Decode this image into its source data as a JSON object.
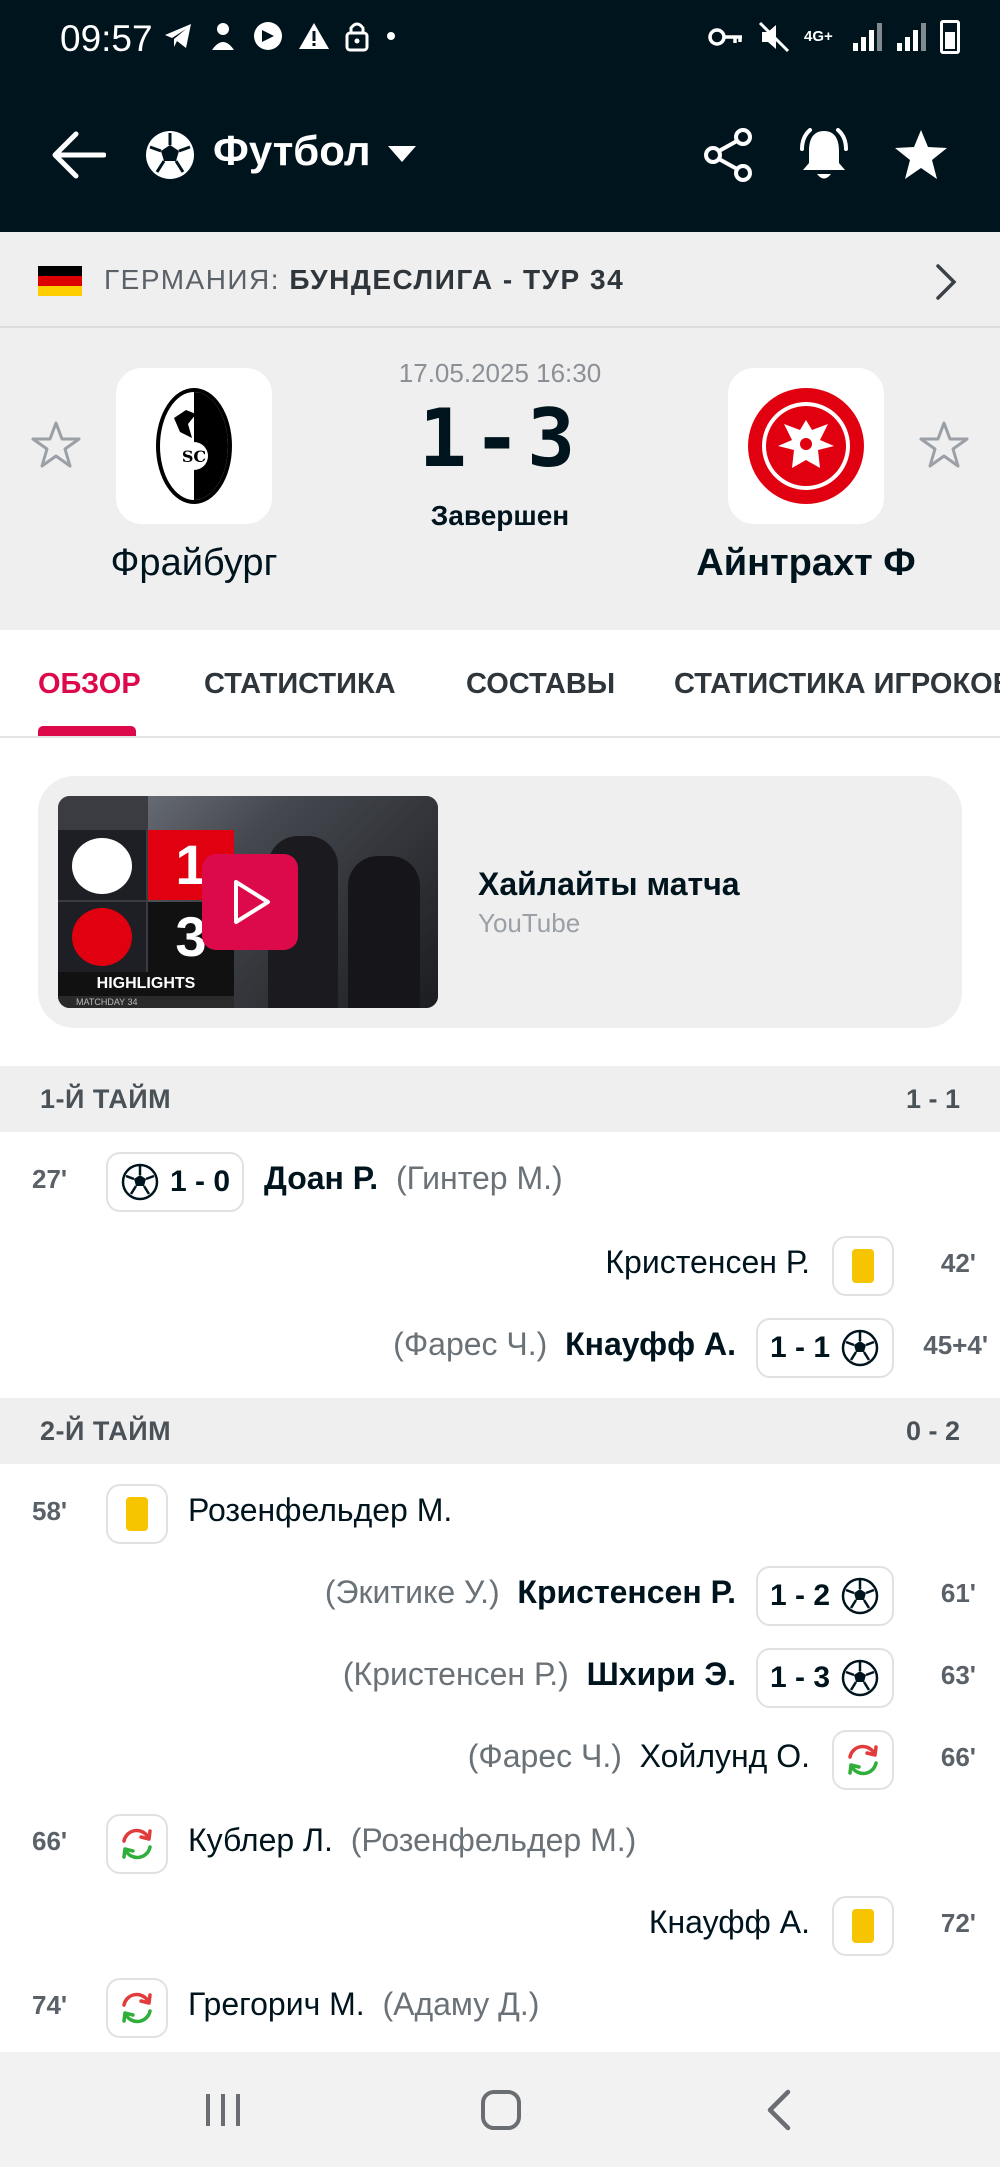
{
  "status_bar": {
    "time": "09:57",
    "left_icons": [
      "telegram-icon",
      "app-icon",
      "app-icon",
      "warning-icon",
      "lock-icon",
      "dot-icon"
    ],
    "right_icons": [
      "key-icon",
      "mute-icon",
      "4g-icon",
      "signal-icon",
      "signal-icon",
      "battery-icon"
    ],
    "network": "4G+"
  },
  "app_bar": {
    "sport": "Футбол",
    "icons": [
      "back-arrow-icon",
      "soccer-ball-icon",
      "chevron-down-icon",
      "share-icon",
      "bell-icon",
      "star-icon"
    ]
  },
  "league": {
    "country": "ГЕРМАНИЯ:",
    "competition": "БУНДЕСЛИГА - ТУР 34"
  },
  "match": {
    "datetime": "17.05.2025 16:30",
    "score": "1-3",
    "status": "Завершен",
    "home_team": "Фрайбург",
    "away_team": "Айнтрахт Ф"
  },
  "tabs": [
    {
      "label": "ОБЗОР",
      "active": true
    },
    {
      "label": "СТАТИСТИКА",
      "active": false
    },
    {
      "label": "СОСТАВЫ",
      "active": false
    },
    {
      "label": "СТАТИСТИКА ИГРОКОВ",
      "active": false
    }
  ],
  "highlights": {
    "title": "Хайлайты матча",
    "source": "YouTube",
    "thumb_home_score": "1",
    "thumb_away_score": "3",
    "thumb_caption": "HIGHLIGHTS",
    "thumb_matchday": "MATCHDAY 34"
  },
  "halves": [
    {
      "label": "1-Й ТАЙМ",
      "score": "1 - 1"
    },
    {
      "label": "2-Й ТАЙМ",
      "score": "0 - 2"
    }
  ],
  "events": [
    {
      "minute": "27'",
      "side": "home",
      "type": "goal",
      "score": "1 - 0",
      "player": "Доан Р.",
      "assist": "(Гинтер М.)"
    },
    {
      "minute": "42'",
      "side": "away",
      "type": "yellow",
      "player": "Кристенсен Р.",
      "assist": ""
    },
    {
      "minute": "45+4'",
      "side": "away",
      "type": "goal",
      "score": "1 - 1",
      "player": "Кнауфф А.",
      "assist": "(Фарес Ч.)"
    },
    {
      "minute": "58'",
      "side": "home",
      "type": "yellow",
      "player": "Розенфельдер М.",
      "assist": ""
    },
    {
      "minute": "61'",
      "side": "away",
      "type": "goal",
      "score": "1 - 2",
      "player": "Кристенсен Р.",
      "assist": "(Экитике У.)"
    },
    {
      "minute": "63'",
      "side": "away",
      "type": "goal",
      "score": "1 - 3",
      "player": "Шхири Э.",
      "assist": "(Кристенсен Р.)"
    },
    {
      "minute": "66'",
      "side": "away",
      "type": "sub",
      "player": "Хойлунд О.",
      "assist": "(Фарес Ч.)"
    },
    {
      "minute": "66'",
      "side": "home",
      "type": "sub",
      "player": "Кублер Л.",
      "assist": "(Розенфельдер М.)"
    },
    {
      "minute": "72'",
      "side": "away",
      "type": "yellow",
      "player": "Кнауфф А.",
      "assist": ""
    },
    {
      "minute": "74'",
      "side": "home",
      "type": "sub",
      "player": "Грегорич М.",
      "assist": "(Адаму Д.)"
    }
  ],
  "nav_icons": [
    "recent-apps-icon",
    "home-icon",
    "back-icon"
  ],
  "colors": {
    "header_bg": "#00141e",
    "accent": "#dc0a4b",
    "yellow_card": "#f7c400",
    "panel_bg": "#efefef"
  }
}
